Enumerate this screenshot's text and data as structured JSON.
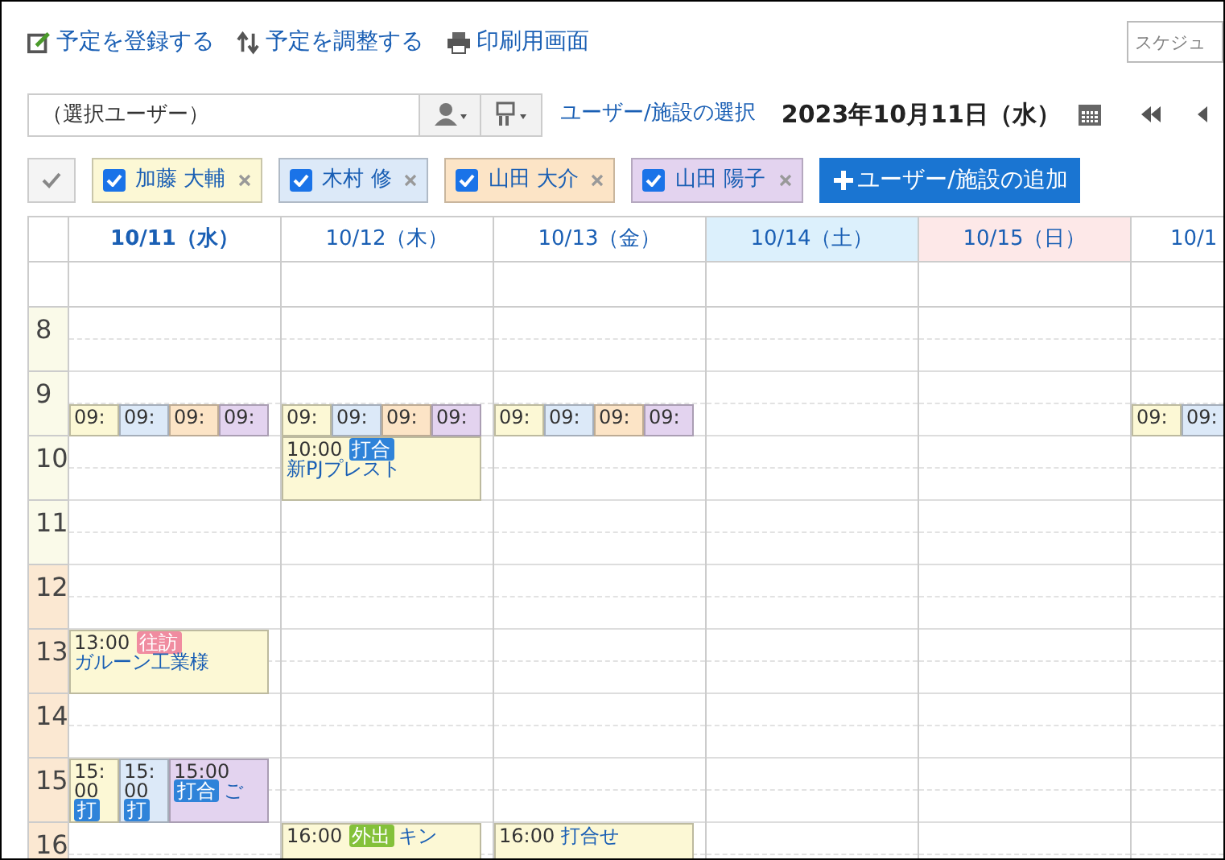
{
  "toolbar": {
    "actions": [
      {
        "kind": "register",
        "label": "予定を登録する"
      },
      {
        "kind": "adjust",
        "label": "予定を調整する"
      },
      {
        "kind": "print",
        "label": "印刷用画面"
      }
    ],
    "search": {
      "placeholder": "スケジュ"
    }
  },
  "selector": {
    "value": "（選択ユーザー）",
    "link": "ユーザー/施設の選択",
    "date": "2023年10月11日（水）"
  },
  "users": [
    {
      "name": "加藤 大輔",
      "checked": true,
      "color": "#fcf8d5"
    },
    {
      "name": "木村 修",
      "checked": true,
      "color": "#dce9f8"
    },
    {
      "name": "山田 大介",
      "checked": true,
      "color": "#fce4c6"
    },
    {
      "name": "山田 陽子",
      "checked": true,
      "color": "#e3d3ef"
    }
  ],
  "add_button": "ユーザー/施設の追加",
  "hours": [
    {
      "label": "8",
      "afternoon": false
    },
    {
      "label": "9",
      "afternoon": false
    },
    {
      "label": "10",
      "afternoon": false
    },
    {
      "label": "11",
      "afternoon": false
    },
    {
      "label": "12",
      "afternoon": true
    },
    {
      "label": "13",
      "afternoon": true
    },
    {
      "label": "14",
      "afternoon": true
    },
    {
      "label": "15",
      "afternoon": true
    },
    {
      "label": "16",
      "afternoon": true
    }
  ],
  "days": [
    {
      "label": "10/11（水）",
      "color": "#ffffff",
      "selected": true,
      "events": [
        {
          "kind": "half",
          "time": "09:",
          "color": "#fcf8d5"
        },
        {
          "kind": "half",
          "time": "09:",
          "color": "#dce9f8"
        },
        {
          "kind": "half",
          "time": "09:",
          "color": "#fce4c6"
        },
        {
          "kind": "half",
          "time": "09:",
          "color": "#e3d3ef"
        },
        {
          "kind": "hour",
          "time": "13:00",
          "tag": {
            "label": "往訪",
            "color": "#f08ca0"
          },
          "title": "ガルーン工業様",
          "color": "#fcf8d5"
        },
        {
          "kind": "hour",
          "time": "15:00",
          "tag": {
            "label": "打",
            "color": "#2f83d9"
          },
          "color": "#fcf8d5"
        },
        {
          "kind": "hour",
          "time": "15:00",
          "tag": {
            "label": "打",
            "color": "#2f83d9"
          },
          "color": "#dce9f8"
        },
        {
          "kind": "hour",
          "time": "15:00",
          "tag": {
            "label": "打合",
            "color": "#2f83d9"
          },
          "title": "ご",
          "color": "#e3d3ef"
        }
      ]
    },
    {
      "label": "10/12（木）",
      "color": "#ffffff",
      "selected": false,
      "events": [
        {
          "kind": "half",
          "time": "09:",
          "color": "#fcf8d5"
        },
        {
          "kind": "half",
          "time": "09:",
          "color": "#dce9f8"
        },
        {
          "kind": "half",
          "time": "09:",
          "color": "#fce4c6"
        },
        {
          "kind": "half",
          "time": "09:",
          "color": "#e3d3ef"
        },
        {
          "kind": "hour",
          "time": "10:00",
          "tag": {
            "label": "打合",
            "color": "#2f83d9"
          },
          "title": "新PJプレスト",
          "color": "#fcf8d5"
        },
        {
          "kind": "hour",
          "time": "16:00",
          "tag": {
            "label": "外出",
            "color": "#84c13a"
          },
          "title": "キン",
          "color": "#fcf8d5"
        }
      ]
    },
    {
      "label": "10/13（金）",
      "color": "#ffffff",
      "selected": false,
      "events": [
        {
          "kind": "half",
          "time": "09:",
          "color": "#fcf8d5"
        },
        {
          "kind": "half",
          "time": "09:",
          "color": "#dce9f8"
        },
        {
          "kind": "half",
          "time": "09:",
          "color": "#fce4c6"
        },
        {
          "kind": "half",
          "time": "09:",
          "color": "#e3d3ef"
        },
        {
          "kind": "hour",
          "time": "16:00",
          "title": "打合せ",
          "color": "#fcf8d5"
        }
      ]
    },
    {
      "label": "10/14（土）",
      "color": "#dcf0fc",
      "selected": false
    },
    {
      "label": "10/15（日）",
      "color": "#fde8e8",
      "selected": false
    },
    {
      "label": "10/1",
      "color": "#ffffff",
      "selected": false,
      "events": [
        {
          "kind": "half",
          "time": "09:",
          "color": "#fcf8d5"
        },
        {
          "kind": "half",
          "time": "09:",
          "color": "#dce9f8"
        }
      ]
    }
  ]
}
